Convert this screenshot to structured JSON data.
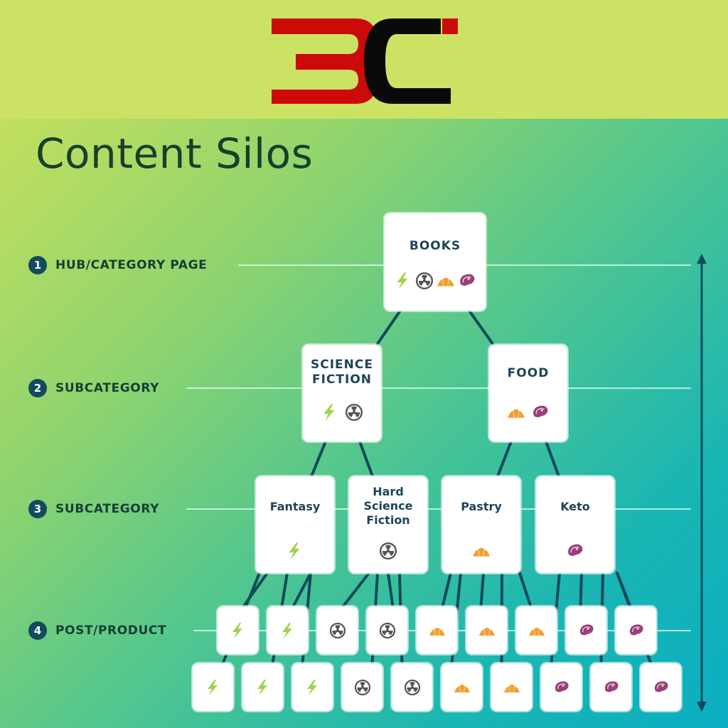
{
  "logo": {
    "text": "3C",
    "colors": {
      "three": "#cc0a0a",
      "c": "#0a0a0a",
      "accent": "#cc0a0a"
    }
  },
  "title": "Content Silos",
  "levels": [
    {
      "number": "1",
      "label": "HUB/CATEGORY PAGE"
    },
    {
      "number": "2",
      "label": "SUBCATEGORY"
    },
    {
      "number": "3",
      "label": "SUBCATEGORY"
    },
    {
      "number": "4",
      "label": "POST/PRODUCT"
    }
  ],
  "colors": {
    "line": "#0f4a5c",
    "label_text": "#1e4456",
    "lightning": "#9fd34b",
    "radiation": "#555555",
    "croissant": "#f0a030",
    "steak": "#9b3f7a"
  },
  "tree": {
    "hub": {
      "label": "BOOKS",
      "icons": [
        "lightning-icon",
        "radiation-icon",
        "croissant-icon",
        "steak-icon"
      ]
    },
    "level2": [
      {
        "label": "SCIENCE FICTION",
        "icons": [
          "lightning-icon",
          "radiation-icon"
        ]
      },
      {
        "label": "FOOD",
        "icons": [
          "croissant-icon",
          "steak-icon"
        ]
      }
    ],
    "level3": [
      {
        "label": "Fantasy",
        "icons": [
          "lightning-icon"
        ],
        "parent": 0
      },
      {
        "label": "Hard Science Fiction",
        "icons": [
          "radiation-icon"
        ],
        "parent": 0
      },
      {
        "label": "Pastry",
        "icons": [
          "croissant-icon"
        ],
        "parent": 1
      },
      {
        "label": "Keto",
        "icons": [
          "steak-icon"
        ],
        "parent": 1
      }
    ],
    "level4_row_a": [
      {
        "icon": "lightning-icon",
        "parent": 0
      },
      {
        "icon": "lightning-icon",
        "parent": 0
      },
      {
        "icon": "radiation-icon",
        "parent": 1
      },
      {
        "icon": "radiation-icon",
        "parent": 1
      },
      {
        "icon": "croissant-icon",
        "parent": 2
      },
      {
        "icon": "croissant-icon",
        "parent": 2
      },
      {
        "icon": "croissant-icon",
        "parent": 2
      },
      {
        "icon": "steak-icon",
        "parent": 3
      },
      {
        "icon": "steak-icon",
        "parent": 3
      }
    ],
    "level4_row_b": [
      {
        "icon": "lightning-icon",
        "parent": 0
      },
      {
        "icon": "lightning-icon",
        "parent": 0
      },
      {
        "icon": "lightning-icon",
        "parent": 0
      },
      {
        "icon": "radiation-icon",
        "parent": 1
      },
      {
        "icon": "radiation-icon",
        "parent": 1
      },
      {
        "icon": "croissant-icon",
        "parent": 2
      },
      {
        "icon": "croissant-icon",
        "parent": 2
      },
      {
        "icon": "steak-icon",
        "parent": 3
      },
      {
        "icon": "steak-icon",
        "parent": 3
      },
      {
        "icon": "steak-icon",
        "parent": 3
      }
    ]
  }
}
